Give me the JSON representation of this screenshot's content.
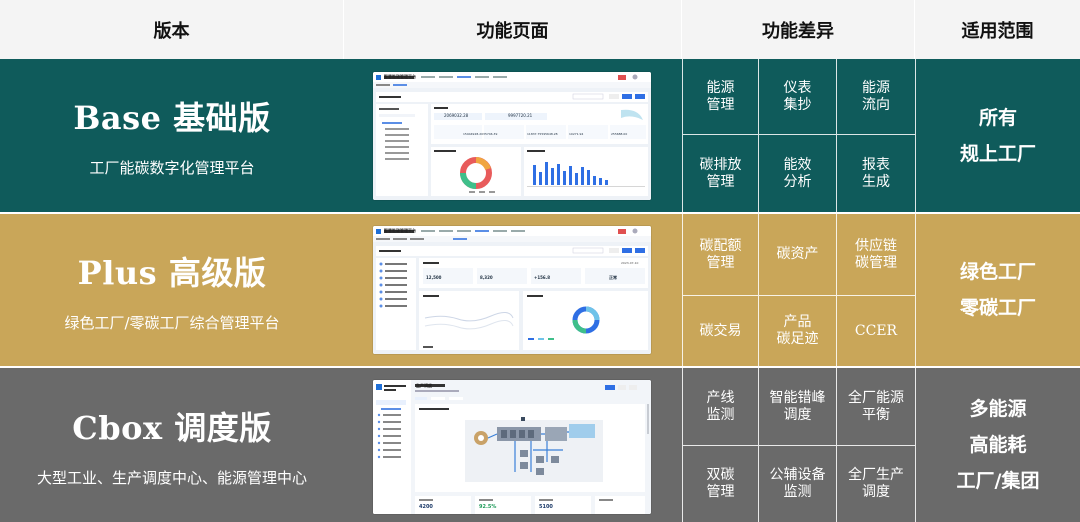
{
  "header": {
    "version": "版本",
    "page": "功能页面",
    "diff": "功能差异",
    "scope": "适用范围"
  },
  "colors": {
    "base": "#0f5b5b",
    "plus": "#c9a659",
    "cbox": "#6a6a6a",
    "header_bg": "#f4f4f4"
  },
  "rows": [
    {
      "name": "Base 基础版",
      "subtitle": "工厂能碳数字化管理平台",
      "features": [
        "能源\n管理",
        "仪表\n集抄",
        "能源\n流向",
        "碳排放\n管理",
        "能效\n分析",
        "报表\n生成"
      ],
      "scope": [
        "所有",
        "规上工厂"
      ],
      "screenshot": {
        "app_title": "智慧能碳管理平台",
        "nums": [
          "2069032.28",
          "9997720.21",
          "15944928.2035746.39",
          "11837.75595648.28",
          "10271.94",
          "255688.00"
        ]
      }
    },
    {
      "name": "Plus 高级版",
      "subtitle": "绿色工厂/零碳工厂综合管理平台",
      "features": [
        "碳配额\n管理",
        "碳资产",
        "供应链\n碳管理",
        "碳交易",
        "产品\n碳足迹",
        "CCER"
      ],
      "scope": [
        "绿色工厂",
        "零碳工厂"
      ],
      "screenshot": {
        "app_title": "智慧能碳管理平台",
        "nums": [
          "12,500",
          "8,320",
          "+156.8",
          "正常",
          "2023-07-10"
        ]
      }
    },
    {
      "name": "Cbox 调度版",
      "subtitle": "大型工业、生产调度中心、能源管理中心",
      "features": [
        "产线\n监测",
        "智能错峰\n调度",
        "全厂能源\n平衡",
        "双碳\n管理",
        "公辅设备\n监测",
        "全厂生产\n调度"
      ],
      "scope": [
        "多能源",
        "高能耗",
        "工厂/集团"
      ],
      "screenshot": {
        "app_title": "生产调度",
        "nums": [
          "4200",
          "92.5%",
          "5100"
        ]
      }
    }
  ]
}
